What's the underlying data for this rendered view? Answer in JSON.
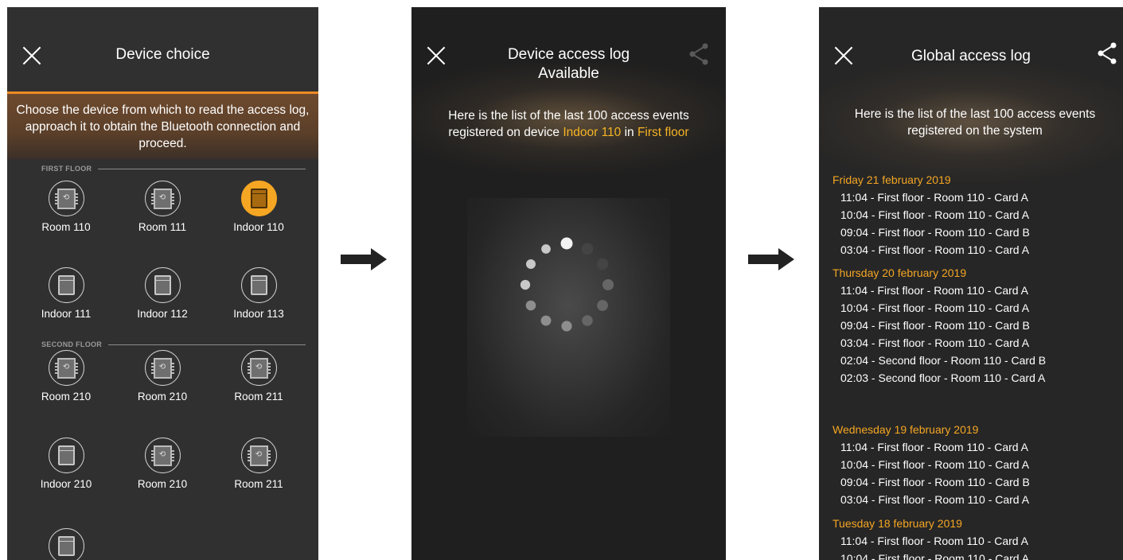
{
  "screen1": {
    "title": "Device choice",
    "intro": "Choose the device from which to read the access log, approach it to obtain the Bluetooth connection and proceed.",
    "floors": [
      {
        "label": "FIRST FLOOR",
        "devices": [
          {
            "name": "Room 110",
            "icon": "keypad-reader-icon",
            "active": false
          },
          {
            "name": "Room 111",
            "icon": "keypad-reader-icon",
            "active": false
          },
          {
            "name": "Indoor 110",
            "icon": "indoor-panel-icon",
            "active": true
          },
          {
            "name": "Indoor 111",
            "icon": "indoor-panel-icon",
            "active": false
          },
          {
            "name": "Indoor 112",
            "icon": "indoor-panel-icon",
            "active": false
          },
          {
            "name": "Indoor 113",
            "icon": "indoor-panel-icon",
            "active": false
          }
        ]
      },
      {
        "label": "SECOND FLOOR",
        "devices": [
          {
            "name": "Room 210",
            "icon": "keypad-reader-icon",
            "active": false
          },
          {
            "name": "Room 210",
            "icon": "keypad-reader-icon",
            "active": false
          },
          {
            "name": "Room 211",
            "icon": "keypad-reader-icon",
            "active": false
          },
          {
            "name": "Indoor 210",
            "icon": "indoor-panel-icon",
            "active": false
          },
          {
            "name": "Room 210",
            "icon": "keypad-reader-icon",
            "active": false
          },
          {
            "name": "Room 211",
            "icon": "keypad-reader-icon",
            "active": false
          },
          {
            "name": "",
            "icon": "indoor-panel-icon",
            "active": false
          }
        ]
      }
    ]
  },
  "screen2": {
    "title_line1": "Device access log",
    "title_line2": "Available",
    "msg_part1": "Here is the list of the last 100 access events registered on device ",
    "device": "Indoor 110",
    "msg_in": " in ",
    "floor": "First floor"
  },
  "screen3": {
    "title": "Global access log",
    "msg": "Here is the list of the last 100 access events registered on the system",
    "days": [
      {
        "date": "Friday 21 february 2019",
        "entries": [
          "11:04 - First floor - Room 110 - Card A",
          "10:04 - First floor - Room 110 - Card A",
          "09:04 - First floor - Room 110 - Card B",
          "03:04 - First floor - Room 110 - Card A"
        ]
      },
      {
        "date": "Thursday 20 february 2019",
        "entries": [
          "11:04 - First floor - Room 110 - Card A",
          "10:04 - First floor - Room 110 - Card A",
          "09:04 - First floor - Room 110 - Card B",
          "03:04 - First floor - Room 110 - Card A",
          "02:04 - Second floor - Room 110 - Card B",
          "02:03 - Second floor - Room 110 - Card A"
        ]
      },
      {
        "date": "Wednesday 19 february 2019",
        "entries": [
          "11:04 - First floor - Room 110 - Card A",
          "10:04 - First floor - Room 110 - Card A",
          "09:04 - First floor - Room 110 - Card B",
          "03:04 - First floor - Room 110 - Card A"
        ]
      },
      {
        "date": "Tuesday 18 february 2019",
        "entries": [
          "11:04 - First floor - Room 110 - Card A",
          "10:04 - First floor - Room 110 - Card A"
        ]
      }
    ]
  },
  "colors": {
    "accent": "#f5a623",
    "divider": "#f08a24"
  }
}
